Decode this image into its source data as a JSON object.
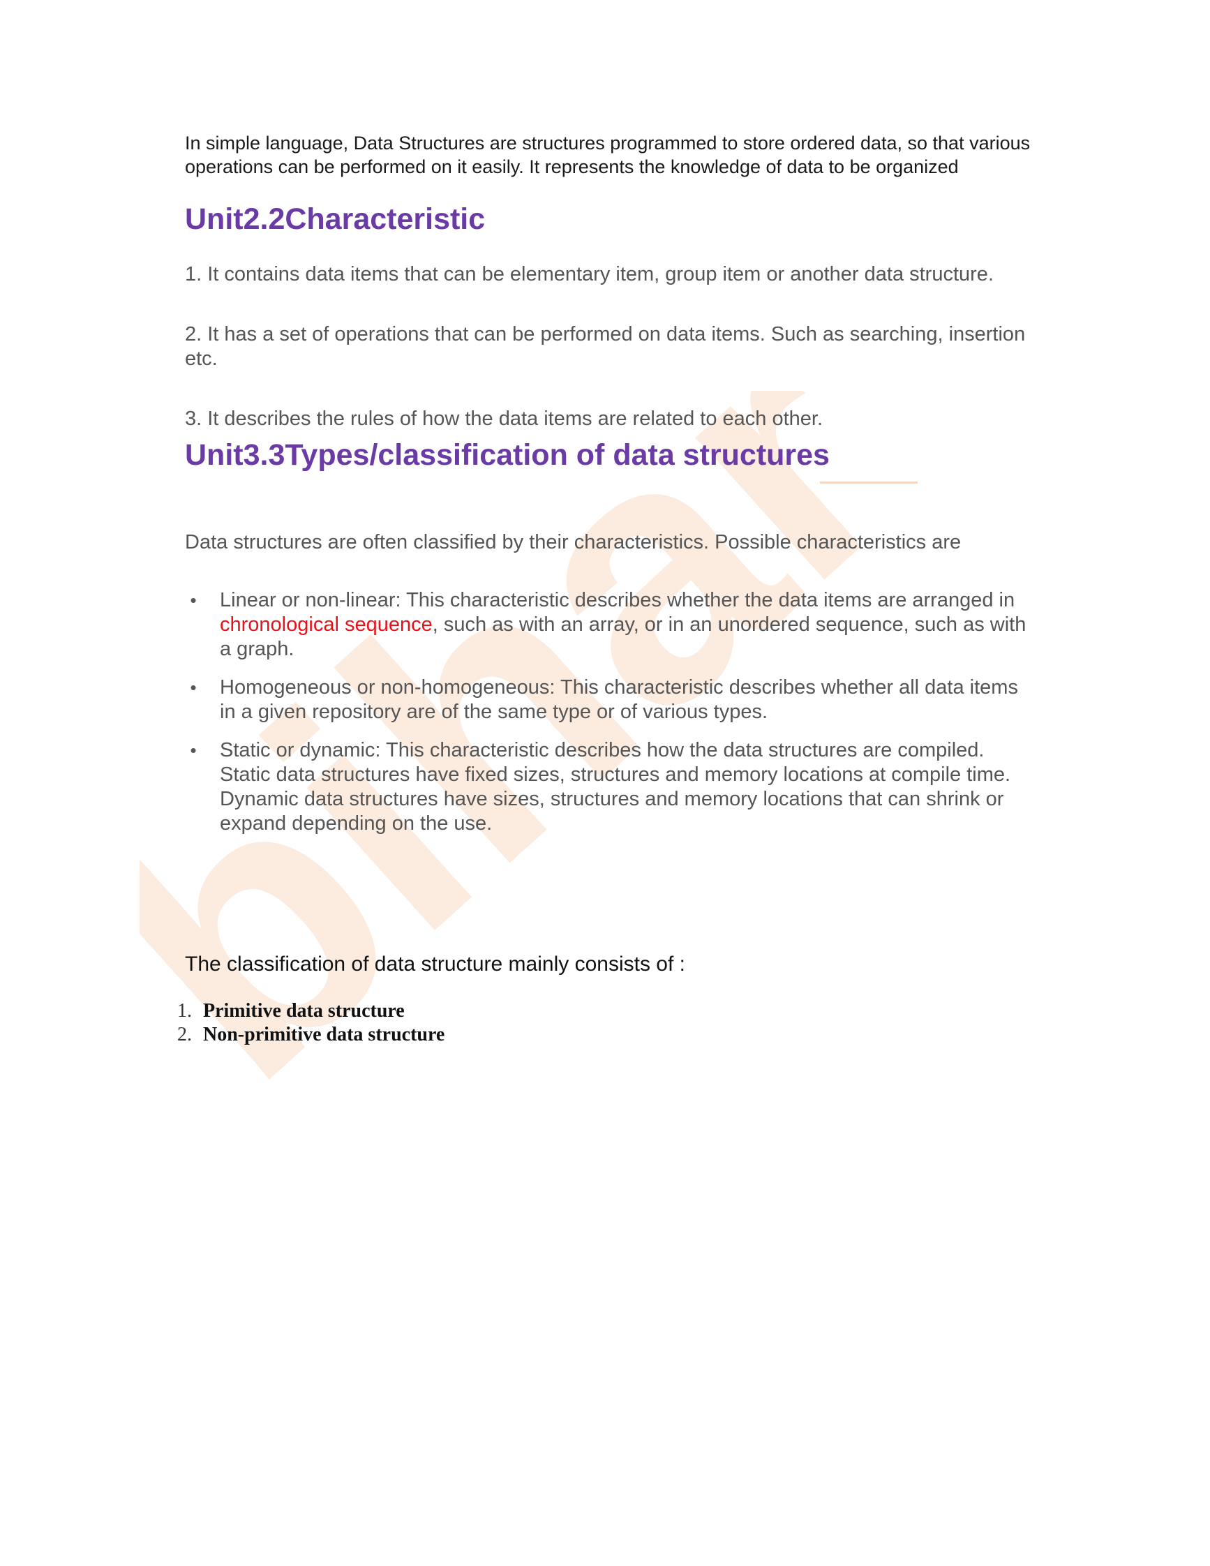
{
  "intro": "In simple language, Data Structures are structures programmed to store ordered data, so that various operations can be performed on it easily. It represents the knowledge of data to be organized",
  "heading_characteristic": "Unit2.2Characteristic",
  "characteristics": [
    "1. It contains data items that can be elementary item, group item or another data structure.",
    "2. It has a set of operations that can be performed on data items. Such as searching, insertion etc.",
    "3. It describes the rules of how the data items are related to each other."
  ],
  "heading_types": "Unit3.3Types/classification of data structures",
  "classified_intro": "Data structures are often classified by their characteristics. Possible characteristics are",
  "bullets": {
    "linear": {
      "before": "Linear or non-linear: This characteristic describes whether the data items are arranged in ",
      "link": "chronological sequence",
      "after": ", such as with an array, or in an unordered sequence, such as with a graph."
    },
    "homogeneous": "Homogeneous or non-homogeneous: This characteristic describes whether all data items in a given repository are of the same type or of various types.",
    "static": "Static or dynamic: This characteristic describes how the data structures are compiled. Static data structures have fixed sizes, structures and memory locations at compile time. Dynamic data structures have sizes, structures and memory locations that can shrink or expand depending on the use."
  },
  "bullet_symbol": "•",
  "consists": "The classification of data structure mainly consists of :",
  "types": [
    {
      "num": "1.",
      "label": "Primitive data structure"
    },
    {
      "num": "2.",
      "label": "Non-primitive data structure"
    }
  ],
  "watermark": "bihar",
  "colors": {
    "heading": "#6a3aa5",
    "link_red": "#e8121b",
    "body_gray": "#555555",
    "watermark": "#f7c9a6"
  }
}
